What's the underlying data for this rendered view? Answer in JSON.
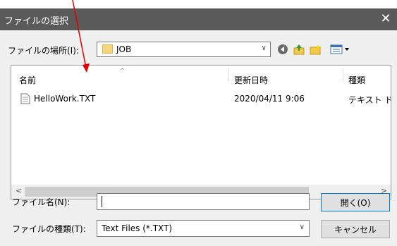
{
  "dialog": {
    "title": "ファイルの選択",
    "close_glyph": "✕"
  },
  "lookin": {
    "label": "ファイルの場所(I):",
    "value": "JOB",
    "caret": "∨"
  },
  "toolbar": {
    "icons": [
      "back-icon",
      "up-folder-icon",
      "new-folder-icon",
      "view-menu-icon"
    ]
  },
  "list": {
    "columns": [
      "名前",
      "更新日時",
      "種類"
    ],
    "sort_glyph": "^",
    "rows": [
      {
        "name": "HelloWork.TXT",
        "date": "2020/04/11 9:06",
        "type": "テキスト ドキ"
      }
    ],
    "scroll_left": "<",
    "scroll_right": ">"
  },
  "filename": {
    "label": "ファイル名(N):",
    "value": ""
  },
  "filetype": {
    "label": "ファイルの種類(T):",
    "value": "Text Files (*.TXT)",
    "caret": "∨"
  },
  "buttons": {
    "open": "開く(O)",
    "cancel": "キャンセル"
  },
  "colors": {
    "titlebar": "#5a5a5a",
    "annotation_arrow": "#e00000",
    "open_button_border": "#0078d7"
  }
}
